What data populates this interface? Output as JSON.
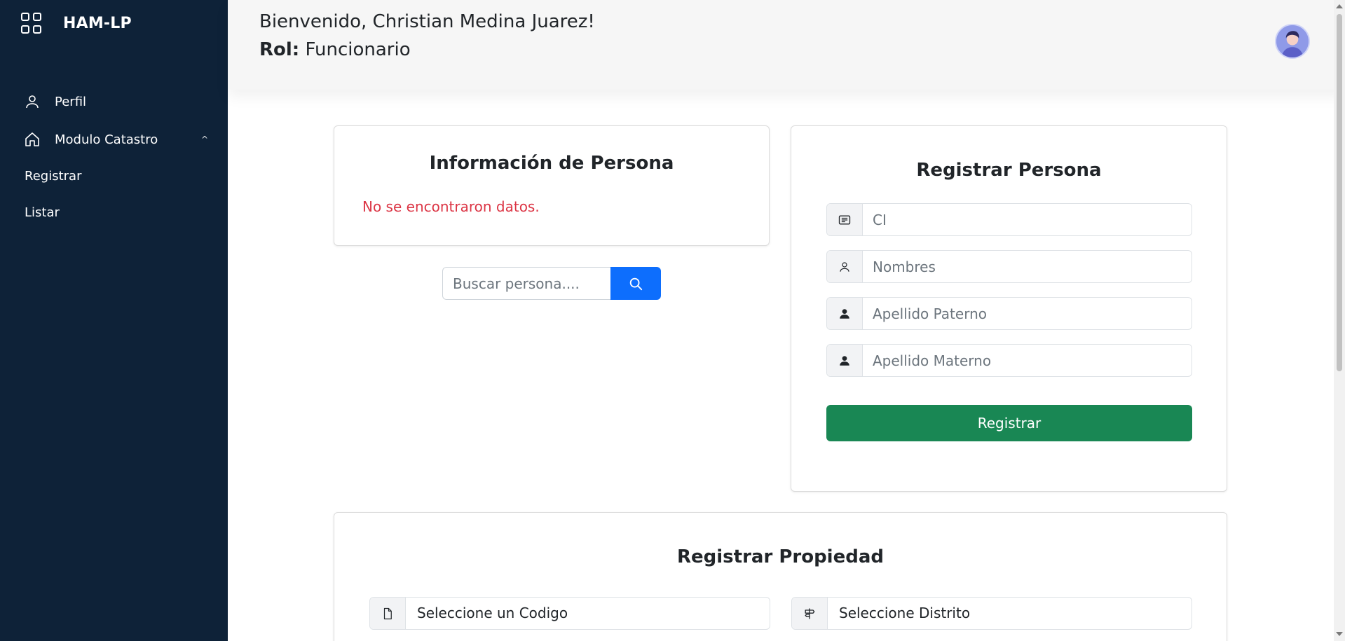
{
  "sidebar": {
    "brand": "HAM-LP",
    "items": [
      {
        "label": "Perfil",
        "icon": "user-icon"
      },
      {
        "label": "Modulo Catastro",
        "icon": "home-icon"
      }
    ],
    "sub_items": [
      {
        "label": "Registrar"
      },
      {
        "label": "Listar"
      }
    ],
    "chevron": "^"
  },
  "header": {
    "welcome": "Bienvenido, Christian Medina Juarez!",
    "role_label": "Rol:",
    "role_value": "Funcionario"
  },
  "info_card": {
    "title": "Información de Persona",
    "empty_message": "No se encontraron datos."
  },
  "search": {
    "placeholder": "Buscar persona...."
  },
  "register_person": {
    "title": "Registrar Persona",
    "fields": [
      {
        "placeholder": "CI",
        "icon": "id-card-icon"
      },
      {
        "placeholder": "Nombres",
        "icon": "user-outline-icon"
      },
      {
        "placeholder": "Apellido Paterno",
        "icon": "user-filled-icon"
      },
      {
        "placeholder": "Apellido Materno",
        "icon": "user-filled-icon"
      }
    ],
    "submit_label": "Registrar"
  },
  "register_property": {
    "title": "Registrar Propiedad",
    "fields": [
      {
        "value": "Seleccione un Codigo",
        "icon": "file-icon"
      },
      {
        "value": "Seleccione Distrito",
        "icon": "signpost-icon"
      }
    ]
  },
  "colors": {
    "sidebar_bg": "#0e2238",
    "primary": "#0d6efd",
    "success": "#198754",
    "danger": "#dc3545"
  }
}
